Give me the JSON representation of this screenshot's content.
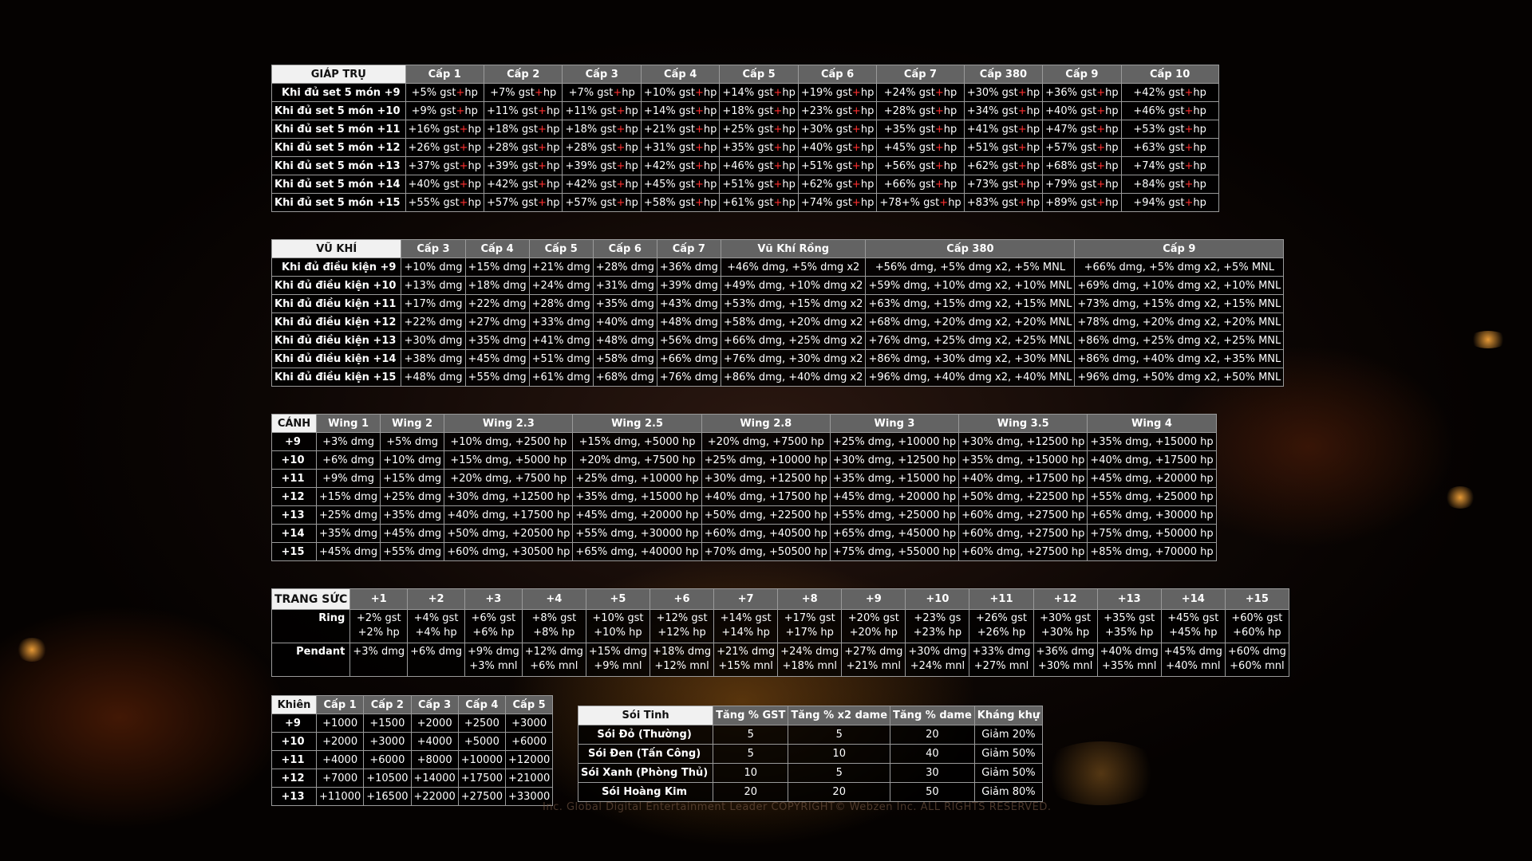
{
  "armor": {
    "title": "GIÁP TRỤ",
    "headers": [
      "Cấp 1",
      "Cấp 2",
      "Cấp 3",
      "Cấp 4",
      "Cấp 5",
      "Cấp 6",
      "Cấp 7",
      "Cấp 380",
      "Cấp 9",
      "Cấp 10"
    ],
    "rows": [
      {
        "label": "Khi đủ set 5 món +9",
        "cells": [
          "+5%",
          "+7%",
          "+7%",
          "+10%",
          "+14%",
          "+19%",
          "+24%",
          "+30%",
          "+36%",
          "+42%"
        ]
      },
      {
        "label": "Khi đủ set 5 món +10",
        "cells": [
          "+9%",
          "+11%",
          "+11%",
          "+14%",
          "+18%",
          "+23%",
          "+28%",
          "+34%",
          "+40%",
          "+46%"
        ]
      },
      {
        "label": "Khi đủ set 5 món +11",
        "cells": [
          "+16%",
          "+18%",
          "+18%",
          "+21%",
          "+25%",
          "+30%",
          "+35%",
          "+41%",
          "+47%",
          "+53%"
        ]
      },
      {
        "label": "Khi đủ set 5 món +12",
        "cells": [
          "+26%",
          "+28%",
          "+28%",
          "+31%",
          "+35%",
          "+40%",
          "+45%",
          "+51%",
          "+57%",
          "+63%"
        ]
      },
      {
        "label": "Khi đủ set 5 món +13",
        "cells": [
          "+37%",
          "+39%",
          "+39%",
          "+42%",
          "+46%",
          "+51%",
          "+56%",
          "+62%",
          "+68%",
          "+74%"
        ]
      },
      {
        "label": "Khi đủ set 5 món +14",
        "cells": [
          "+40%",
          "+42%",
          "+42%",
          "+45%",
          "+51%",
          "+62%",
          "+66%",
          "+73%",
          "+79%",
          "+84%"
        ]
      },
      {
        "label": "Khi đủ set 5 món +15",
        "cells": [
          "+55%",
          "+57%",
          "+57%",
          "+58%",
          "+61%",
          "+74%",
          "+78+%",
          "+83%",
          "+89%",
          "+94%"
        ]
      }
    ]
  },
  "weapon": {
    "title": "VŨ KHÍ",
    "headers": [
      "Cấp 3",
      "Cấp 4",
      "Cấp 5",
      "Cấp 6",
      "Cấp 7",
      "Vũ Khí Rồng",
      "Cấp 380",
      "Cấp 9"
    ],
    "rows": [
      {
        "label": "Khi đủ điều kiện +9",
        "cells": [
          "+10% dmg",
          "+15% dmg",
          "+21% dmg",
          "+28% dmg",
          "+36% dmg",
          "+46% dmg, +5% dmg x2",
          "+56% dmg, +5% dmg x2, +5% MNL",
          "+66% dmg, +5% dmg x2, +5% MNL"
        ]
      },
      {
        "label": "Khi đủ điều kiện +10",
        "cells": [
          "+13% dmg",
          "+18% dmg",
          "+24% dmg",
          "+31% dmg",
          "+39% dmg",
          "+49% dmg, +10% dmg x2",
          "+59% dmg, +10% dmg x2, +10% MNL",
          "+69% dmg, +10% dmg x2, +10% MNL"
        ]
      },
      {
        "label": "Khi đủ điều kiện +11",
        "cells": [
          "+17% dmg",
          "+22% dmg",
          "+28% dmg",
          "+35% dmg",
          "+43% dmg",
          "+53% dmg, +15% dmg x2",
          "+63% dmg, +15% dmg x2, +15% MNL",
          "+73% dmg, +15% dmg x2, +15% MNL"
        ]
      },
      {
        "label": "Khi đủ điều kiện +12",
        "cells": [
          "+22% dmg",
          "+27% dmg",
          "+33% dmg",
          "+40% dmg",
          "+48% dmg",
          "+58% dmg, +20% dmg x2",
          "+68% dmg, +20% dmg x2, +20% MNL",
          "+78% dmg, +20% dmg x2, +20% MNL"
        ]
      },
      {
        "label": "Khi đủ điều kiện +13",
        "cells": [
          "+30% dmg",
          "+35% dmg",
          "+41% dmg",
          "+48% dmg",
          "+56% dmg",
          "+66% dmg, +25% dmg x2",
          "+76% dmg, +25% dmg x2, +25% MNL",
          "+86% dmg, +25% dmg x2, +25% MNL"
        ]
      },
      {
        "label": "Khi đủ điều kiện +14",
        "cells": [
          "+38% dmg",
          "+45% dmg",
          "+51% dmg",
          "+58% dmg",
          "+66% dmg",
          "+76% dmg, +30% dmg x2",
          "+86% dmg, +30% dmg x2, +30% MNL",
          "+86% dmg, +40% dmg x2, +35% MNL"
        ]
      },
      {
        "label": "Khi đủ điều kiện +15",
        "cells": [
          "+48% dmg",
          "+55% dmg",
          "+61% dmg",
          "+68% dmg",
          "+76% dmg",
          "+86% dmg, +40% dmg x2",
          "+96% dmg, +40% dmg x2, +40% MNL",
          "+96% dmg, +50% dmg x2, +50% MNL"
        ]
      }
    ]
  },
  "wing": {
    "title": "CÁNH",
    "headers": [
      "Wing 1",
      "Wing 2",
      "Wing 2.3",
      "Wing 2.5",
      "Wing 2.8",
      "Wing 3",
      "Wing 3.5",
      "Wing 4"
    ],
    "rows": [
      {
        "label": "+9",
        "cells": [
          "+3% dmg",
          "+5% dmg",
          "+10% dmg, +2500 hp",
          "+15% dmg, +5000 hp",
          "+20% dmg, +7500 hp",
          "+25% dmg, +10000 hp",
          "+30% dmg, +12500 hp",
          "+35% dmg, +15000 hp"
        ]
      },
      {
        "label": "+10",
        "cells": [
          "+6% dmg",
          "+10% dmg",
          "+15% dmg, +5000 hp",
          "+20% dmg, +7500 hp",
          "+25% dmg, +10000 hp",
          "+30% dmg, +12500 hp",
          "+35% dmg, +15000 hp",
          "+40% dmg, +17500 hp"
        ]
      },
      {
        "label": "+11",
        "cells": [
          "+9% dmg",
          "+15% dmg",
          "+20% dmg, +7500 hp",
          "+25% dmg, +10000 hp",
          "+30% dmg, +12500 hp",
          "+35% dmg, +15000 hp",
          "+40% dmg, +17500 hp",
          "+45% dmg, +20000 hp"
        ]
      },
      {
        "label": "+12",
        "cells": [
          "+15% dmg",
          "+25% dmg",
          "+30% dmg, +12500 hp",
          "+35% dmg, +15000 hp",
          "+40% dmg, +17500 hp",
          "+45% dmg, +20000 hp",
          "+50% dmg, +22500 hp",
          "+55% dmg, +25000 hp"
        ]
      },
      {
        "label": "+13",
        "cells": [
          "+25% dmg",
          "+35% dmg",
          "+40% dmg, +17500 hp",
          "+45% dmg, +20000 hp",
          "+50% dmg, +22500 hp",
          "+55% dmg, +25000 hp",
          "+60% dmg, +27500 hp",
          "+65% dmg, +30000 hp"
        ]
      },
      {
        "label": "+14",
        "cells": [
          "+35% dmg",
          "+45% dmg",
          "+50% dmg, +20500 hp",
          "+55% dmg, +30000 hp",
          "+60% dmg, +40500 hp",
          "+65% dmg, +45000 hp",
          "+60% dmg, +27500 hp",
          "+75% dmg, +50000 hp"
        ]
      },
      {
        "label": "+15",
        "cells": [
          "+45% dmg",
          "+55% dmg",
          "+60% dmg, +30500 hp",
          "+65% dmg, +40000 hp",
          "+70% dmg, +50500 hp",
          "+75% dmg, +55000 hp",
          "+60% dmg, +27500 hp",
          "+85% dmg, +70000 hp"
        ]
      }
    ]
  },
  "jewelry": {
    "title": "TRANG SỨC",
    "headers": [
      "+1",
      "+2",
      "+3",
      "+4",
      "+5",
      "+6",
      "+7",
      "+8",
      "+9",
      "+10",
      "+11",
      "+12",
      "+13",
      "+14",
      "+15"
    ],
    "rows": [
      {
        "label": "Ring",
        "cells": [
          [
            "+2% gst",
            "+2% hp"
          ],
          [
            "+4% gst",
            "+4% hp"
          ],
          [
            "+6% gst",
            "+6% hp"
          ],
          [
            "+8% gst",
            "+8% hp"
          ],
          [
            "+10% gst",
            "+10% hp"
          ],
          [
            "+12% gst",
            "+12% hp"
          ],
          [
            "+14% gst",
            "+14% hp"
          ],
          [
            "+17% gst",
            "+17% hp"
          ],
          [
            "+20% gst",
            "+20% hp"
          ],
          [
            "+23% gs",
            "+23% hp"
          ],
          [
            "+26% gst",
            "+26% hp"
          ],
          [
            "+30% gst",
            "+30% hp"
          ],
          [
            "+35% gst",
            "+35% hp"
          ],
          [
            "+45% gst",
            "+45% hp"
          ],
          [
            "+60% gst",
            "+60% hp"
          ]
        ]
      },
      {
        "label": "Pendant",
        "cells": [
          [
            "+3% dmg",
            ""
          ],
          [
            "+6% dmg",
            ""
          ],
          [
            "+9% dmg",
            "+3% mnl"
          ],
          [
            "+12% dmg",
            "+6% mnl"
          ],
          [
            "+15% dmg",
            "+9% mnl"
          ],
          [
            "+18% dmg",
            "+12% mnl"
          ],
          [
            "+21% dmg",
            "+15% mnl"
          ],
          [
            "+24% dmg",
            "+18% mnl"
          ],
          [
            "+27% dmg",
            "+21% mnl"
          ],
          [
            "+30% dmg",
            "+24% mnl"
          ],
          [
            "+33% dmg",
            "+27% mnl"
          ],
          [
            "+36% dmg",
            "+30% mnl"
          ],
          [
            "+40% dmg",
            "+35% mnl"
          ],
          [
            "+45% dmg",
            "+40% mnl"
          ],
          [
            "+60% dmg",
            "+60% mnl"
          ]
        ]
      }
    ]
  },
  "shield": {
    "title": "Khiên",
    "headers": [
      "Cấp 1",
      "Cấp 2",
      "Cấp 3",
      "Cấp 4",
      "Cấp 5"
    ],
    "rows": [
      {
        "label": "+9",
        "cells": [
          "+1000",
          "+1500",
          "+2000",
          "+2500",
          "+3000"
        ]
      },
      {
        "label": "+10",
        "cells": [
          "+2000",
          "+3000",
          "+4000",
          "+5000",
          "+6000"
        ]
      },
      {
        "label": "+11",
        "cells": [
          "+4000",
          "+6000",
          "+8000",
          "+10000",
          "+12000"
        ]
      },
      {
        "label": "+12",
        "cells": [
          "+7000",
          "+10500",
          "+14000",
          "+17500",
          "+21000"
        ]
      },
      {
        "label": "+13",
        "cells": [
          "+11000",
          "+16500",
          "+22000",
          "+27500",
          "+33000"
        ]
      }
    ]
  },
  "wolf": {
    "title": "Sói Tinh",
    "headers": [
      "Tăng % GST",
      "Tăng % x2 dame",
      "Tăng % dame",
      "Kháng khự"
    ],
    "rows": [
      {
        "label": "Sói Đỏ (Thường)",
        "cells": [
          "5",
          "5",
          "20",
          "Giảm 20%"
        ]
      },
      {
        "label": "Sói Đen (Tấn Công)",
        "cells": [
          "5",
          "10",
          "40",
          "Giảm 50%"
        ]
      },
      {
        "label": "Sói Xanh (Phòng Thủ)",
        "cells": [
          "10",
          "5",
          "30",
          "Giảm 50%"
        ]
      },
      {
        "label": "Sói Hoàng Kim",
        "cells": [
          "20",
          "20",
          "50",
          "Giảm 80%"
        ]
      }
    ]
  },
  "armor_suffix": {
    "gst": " gst",
    "plus": "+",
    "hp": "hp"
  },
  "footer": "Inc. Global Digital Entertainment Leader COPYRIGHT© Webzen Inc. ALL RIGHTS RESERVED."
}
